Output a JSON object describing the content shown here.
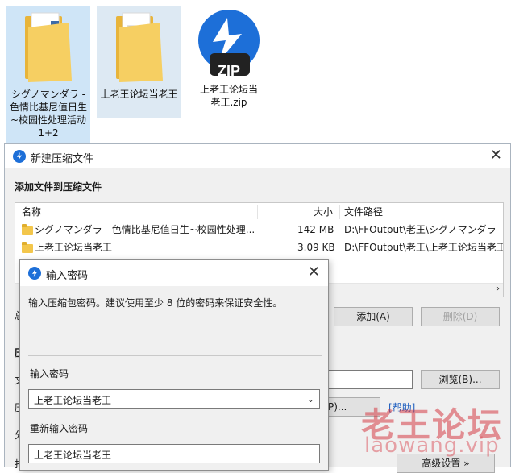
{
  "desktop": {
    "icons": [
      {
        "label": "シグノマンダラ - 色情比基尼值日生~校园性处理活动 1+2"
      },
      {
        "label": "上老王论坛当老王"
      },
      {
        "label": "上老王论坛当老王.zip"
      }
    ],
    "zip_badge": "ZIP"
  },
  "main_window": {
    "title": "新建压缩文件",
    "section_title": "添加文件到压缩文件",
    "columns": [
      "名称",
      "大小",
      "文件路径"
    ],
    "rows": [
      {
        "name": "シグノマンダラ - 色情比基尼值日生~校园性处理...",
        "size": "142 MB",
        "path": "D:\\FFOutput\\老王\\シグノマンダラ -"
      },
      {
        "name": "上老王论坛当老王",
        "size": "3.09 KB",
        "path": "D:\\FFOutput\\老王\\上老王论坛当老王"
      }
    ],
    "partial_labels": {
      "total": "总",
      "compress": "压",
      "file": "文",
      "compress2": "压",
      "split": "分",
      "open": "打"
    },
    "buttons": {
      "add": "添加(A)",
      "delete": "删除(D)",
      "browse": "浏览(B)...",
      "password_fragment": "P)...",
      "help": "[帮助]",
      "advanced": "高级设置 »"
    }
  },
  "password_dialog": {
    "title": "输入密码",
    "instruction": "输入压缩包密码。建议使用至少 8 位的密码来保证安全性。",
    "password_label": "输入密码",
    "password_value": "上老王论坛当老王",
    "confirm_label": "重新输入密码",
    "confirm_value": "上老王论坛当老王"
  },
  "watermark": {
    "line1": "老王论坛",
    "line2": "laowang.vip"
  },
  "colors": {
    "accent": "#1d6fd8",
    "watermark": "#d63c46",
    "selection": "#cfe5f7"
  }
}
